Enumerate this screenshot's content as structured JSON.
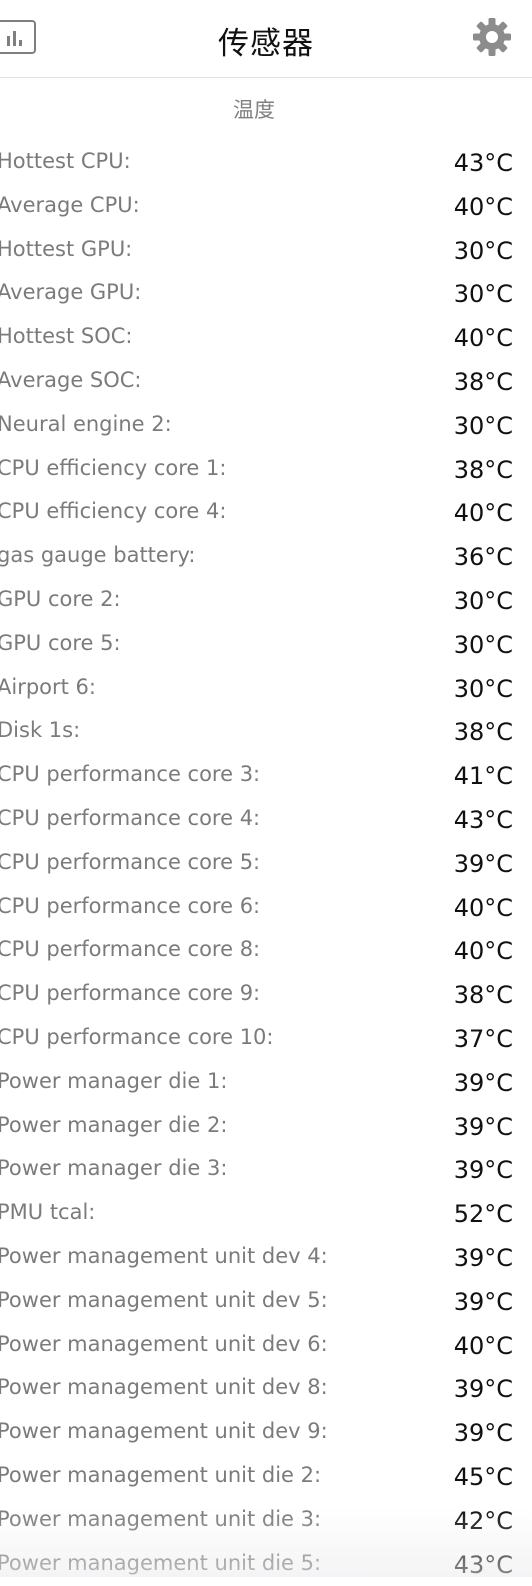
{
  "header": {
    "title": "传感器",
    "stats_icon": "bar-chart-icon",
    "settings_icon": "gear-icon"
  },
  "section": {
    "title": "温度"
  },
  "sensors": [
    {
      "name": "Hottest CPU:",
      "value": "43°C"
    },
    {
      "name": "Average CPU:",
      "value": "40°C"
    },
    {
      "name": "Hottest GPU:",
      "value": "30°C"
    },
    {
      "name": "Average GPU:",
      "value": "30°C"
    },
    {
      "name": "Hottest SOC:",
      "value": "40°C"
    },
    {
      "name": "Average SOC:",
      "value": "38°C"
    },
    {
      "name": "Neural engine 2:",
      "value": "30°C"
    },
    {
      "name": "CPU efficiency core 1:",
      "value": "38°C"
    },
    {
      "name": "CPU efficiency core 4:",
      "value": "40°C"
    },
    {
      "name": "gas gauge battery:",
      "value": "36°C"
    },
    {
      "name": "GPU core 2:",
      "value": "30°C"
    },
    {
      "name": "GPU core 5:",
      "value": "30°C"
    },
    {
      "name": "Airport 6:",
      "value": "30°C"
    },
    {
      "name": "Disk 1s:",
      "value": "38°C"
    },
    {
      "name": "CPU performance core 3:",
      "value": "41°C"
    },
    {
      "name": "CPU performance core 4:",
      "value": "43°C"
    },
    {
      "name": "CPU performance core 5:",
      "value": "39°C"
    },
    {
      "name": "CPU performance core 6:",
      "value": "40°C"
    },
    {
      "name": "CPU performance core 8:",
      "value": "40°C"
    },
    {
      "name": "CPU performance core 9:",
      "value": "38°C"
    },
    {
      "name": "CPU performance core 10:",
      "value": "37°C"
    },
    {
      "name": "Power manager die 1:",
      "value": "39°C"
    },
    {
      "name": "Power manager die 2:",
      "value": "39°C"
    },
    {
      "name": "Power manager die 3:",
      "value": "39°C"
    },
    {
      "name": "PMU tcal:",
      "value": "52°C"
    },
    {
      "name": "Power management unit dev 4:",
      "value": "39°C"
    },
    {
      "name": "Power management unit dev 5:",
      "value": "39°C"
    },
    {
      "name": "Power management unit dev 6:",
      "value": "40°C"
    },
    {
      "name": "Power management unit dev 8:",
      "value": "39°C"
    },
    {
      "name": "Power management unit dev 9:",
      "value": "39°C"
    },
    {
      "name": "Power management unit die 2:",
      "value": "45°C"
    },
    {
      "name": "Power management unit die 3:",
      "value": "42°C"
    },
    {
      "name": "Power management unit die 5:",
      "value": "43°C"
    }
  ]
}
